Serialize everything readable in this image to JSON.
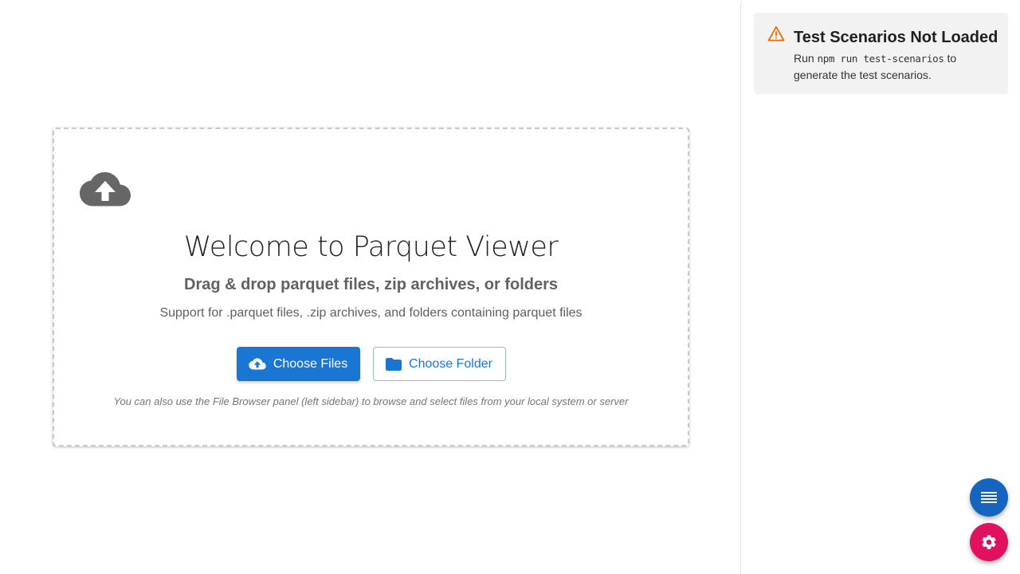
{
  "upload_area": {
    "icon": "cloud-upload-icon",
    "title": "Welcome to Parquet Viewer",
    "subtitle": "Drag & drop parquet files, zip archives, or folders",
    "support_text": "Support for .parquet files, .zip archives, and folders containing parquet files",
    "choose_files_label": "Choose Files",
    "choose_folder_label": "Choose Folder",
    "hint": "You can also use the File Browser panel (left sidebar) to browse and select files from your local system or server"
  },
  "alert": {
    "icon": "warning-icon",
    "title": "Test Scenarios Not Loaded",
    "body_prefix": "Run",
    "command": "npm run test-scenarios",
    "body_suffix": "to",
    "body_line2": "generate the test scenarios."
  },
  "fabs": {
    "list_icon": "list-icon",
    "settings_icon": "gear-icon"
  },
  "colors": {
    "primary": "#1976d2",
    "warning": "#ed6c02",
    "settings_fab": "#e0115f",
    "list_fab": "#1565c0"
  }
}
